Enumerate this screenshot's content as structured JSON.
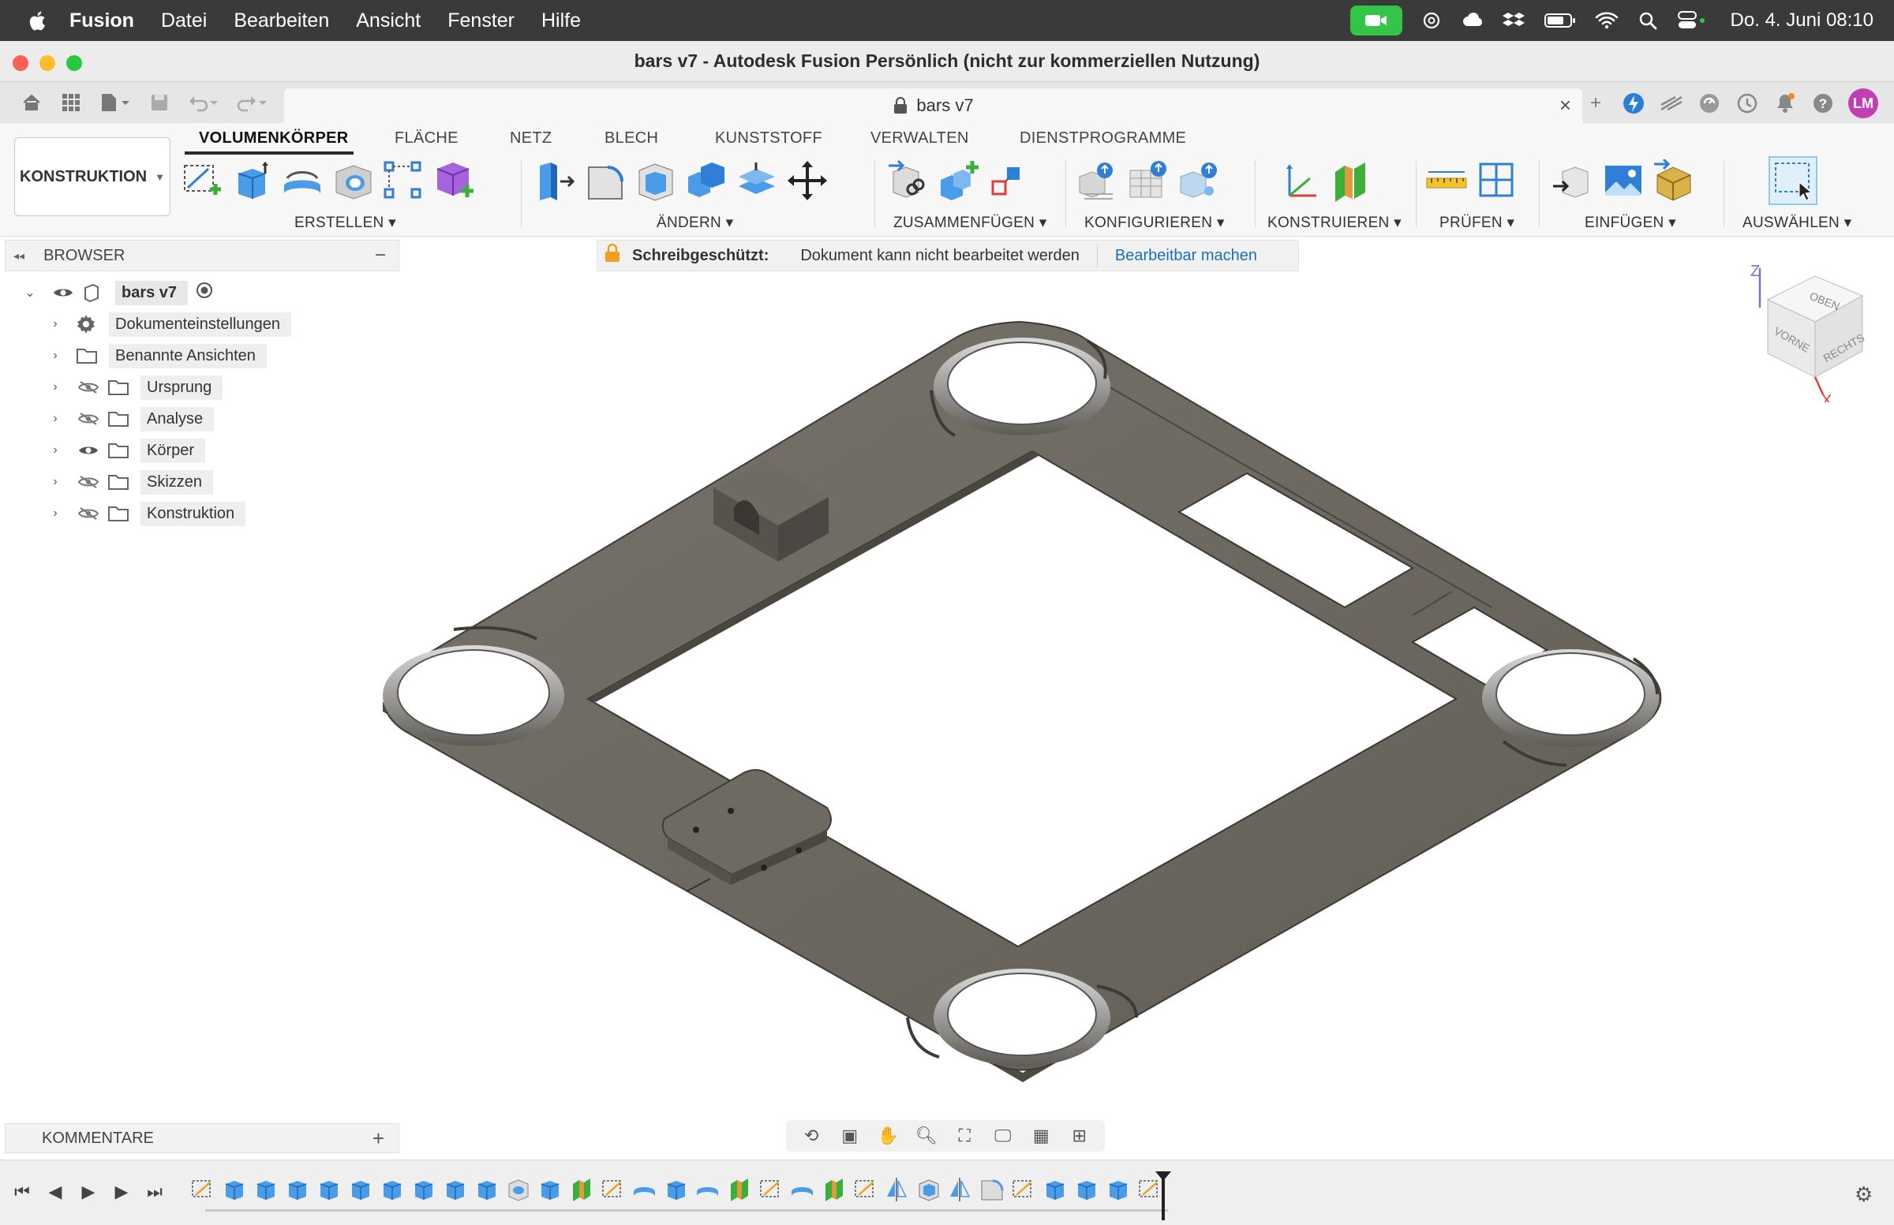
{
  "menubar": {
    "app": "Fusion",
    "items": [
      "Datei",
      "Bearbeiten",
      "Ansicht",
      "Fenster",
      "Hilfe"
    ],
    "clock": "Do. 4. Juni 08:10"
  },
  "window": {
    "title": "bars v7 - Autodesk Fusion Persönlich (nicht zur kommerziellen Nutzung)"
  },
  "doc_tab": {
    "label": "bars v7"
  },
  "user": {
    "initials": "LM"
  },
  "workspace": {
    "label": "KONSTRUKTION"
  },
  "ribbon_tabs": [
    "VOLUMENKÖRPER",
    "FLÄCHE",
    "NETZ",
    "BLECH",
    "KUNSTSTOFF",
    "VERWALTEN",
    "DIENSTPROGRAMME"
  ],
  "groups": {
    "erstellen": "ERSTELLEN ▾",
    "aendern": "ÄNDERN ▾",
    "zusammenfuegen": "ZUSAMMENFÜGEN ▾",
    "konfigurieren": "KONFIGURIEREN ▾",
    "konstruieren": "KONSTRUIEREN ▾",
    "pruefen": "PRÜFEN ▾",
    "einfuegen": "EINFÜGEN ▾",
    "auswaehlen": "AUSWÄHLEN ▾"
  },
  "browser": {
    "title": "BROWSER",
    "root": "bars v7",
    "items": [
      {
        "label": "Dokumenteinstellungen"
      },
      {
        "label": "Benannte Ansichten"
      },
      {
        "label": "Ursprung"
      },
      {
        "label": "Analyse"
      },
      {
        "label": "Körper"
      },
      {
        "label": "Skizzen"
      },
      {
        "label": "Konstruktion"
      }
    ]
  },
  "notice": {
    "bold": "Schreibgeschützt:",
    "text": "Dokument kann nicht bearbeitet werden",
    "link": "Bearbeitbar machen"
  },
  "viewcube": {
    "top": "OBEN",
    "front": "VORNE",
    "right": "RECHTS",
    "z": "Z",
    "x": "X"
  },
  "comments": {
    "label": "KOMMENTARE"
  },
  "colors": {
    "body_fill": "#6e6a62",
    "body_dark": "#55524b",
    "accent_blue": "#3d8fe0",
    "accent_green": "#3cae3c"
  }
}
